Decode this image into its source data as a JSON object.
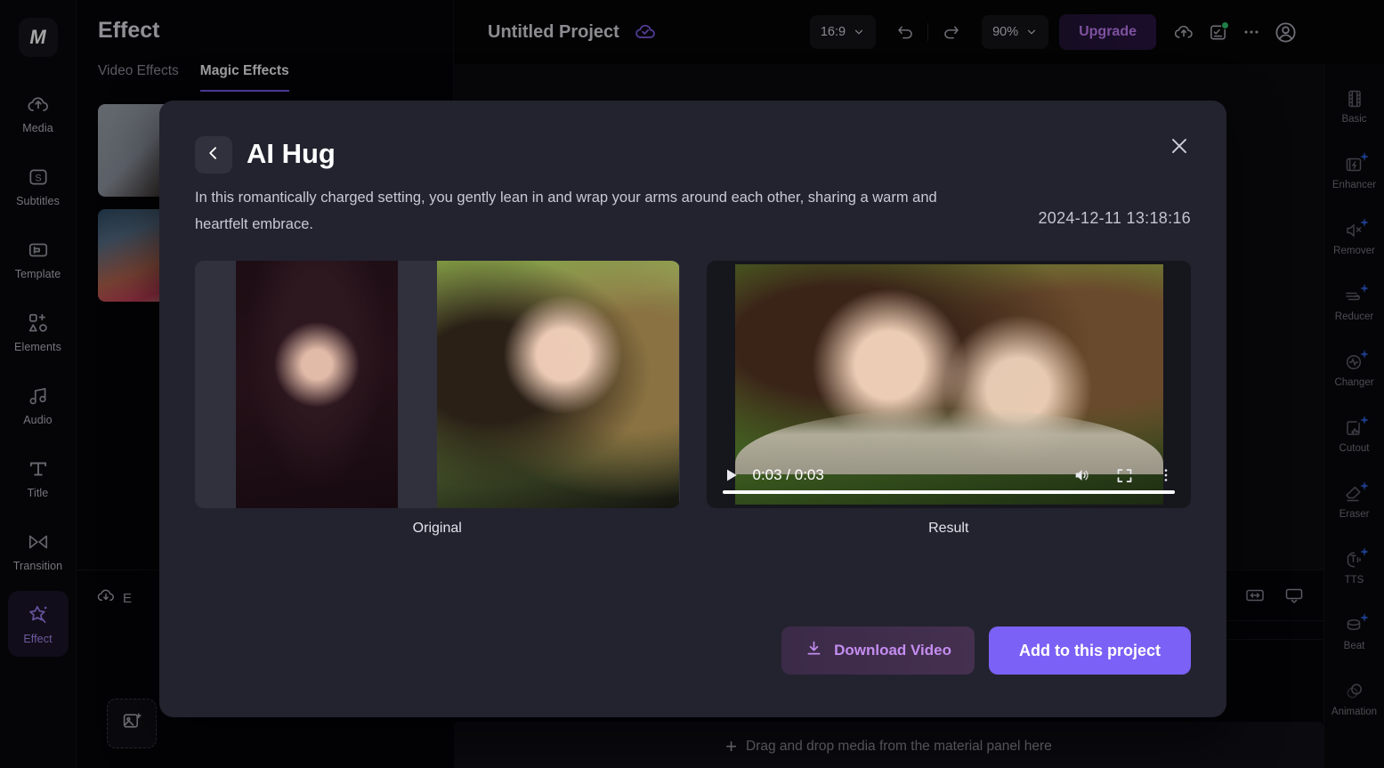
{
  "left_rail": {
    "logo": "M",
    "items": [
      {
        "label": "Media",
        "icon": "cloud-upload-icon",
        "active": false
      },
      {
        "label": "Subtitles",
        "icon": "subtitles-icon",
        "active": false
      },
      {
        "label": "Template",
        "icon": "template-icon",
        "active": false
      },
      {
        "label": "Elements",
        "icon": "elements-icon",
        "active": false
      },
      {
        "label": "Audio",
        "icon": "audio-note-icon",
        "active": false
      },
      {
        "label": "Title",
        "icon": "text-title-icon",
        "active": false
      },
      {
        "label": "Transition",
        "icon": "transition-icon",
        "active": false
      },
      {
        "label": "Effect",
        "icon": "magic-wand-star-icon",
        "active": true
      }
    ]
  },
  "effect_panel": {
    "title": "Effect",
    "tabs": [
      {
        "label": "Video Effects",
        "active": false
      },
      {
        "label": "Magic Effects",
        "active": true
      }
    ]
  },
  "topbar": {
    "project_title": "Untitled Project",
    "cloud_status_icon": "cloud-saved-icon",
    "aspect_ratio": "16:9",
    "undo_icon": "undo-icon",
    "redo_icon": "redo-icon",
    "zoom": "90%",
    "upgrade_label": "Upgrade",
    "export_icon": "cloud-export-icon",
    "tasks_icon": "task-list-icon",
    "more_icon": "more-horizontal-icon",
    "account_icon": "account-circle-icon"
  },
  "right_rail": {
    "items": [
      {
        "label": "Basic",
        "icon": "film-basic-icon",
        "ai": false
      },
      {
        "label": "Enhancer",
        "icon": "video-enhancer-icon",
        "ai": true
      },
      {
        "label": "Remover",
        "icon": "noise-remover-icon",
        "ai": true
      },
      {
        "label": "Reducer",
        "icon": "wind-reducer-icon",
        "ai": true
      },
      {
        "label": "Changer",
        "icon": "voice-changer-icon",
        "ai": true
      },
      {
        "label": "Cutout",
        "icon": "smart-cutout-icon",
        "ai": true
      },
      {
        "label": "Eraser",
        "icon": "eraser-icon",
        "ai": true
      },
      {
        "label": "TTS",
        "icon": "text-to-speech-icon",
        "ai": true
      },
      {
        "label": "Beat",
        "icon": "beat-detect-icon",
        "ai": true
      },
      {
        "label": "Animation",
        "icon": "animation-icon",
        "ai": false
      }
    ]
  },
  "timeline": {
    "export_label": "E",
    "export_icon": "cloud-download-icon",
    "fit_icon": "fit-timeline-icon",
    "display_icon": "display-ratio-icon",
    "add_media_icon": "add-image-icon",
    "dropzone_text": "Drag and drop media from the material panel here",
    "dropzone_plus": "+"
  },
  "modal": {
    "back_icon": "chevron-left-icon",
    "title": "AI Hug",
    "close_icon": "close-icon",
    "description": "In this romantically charged setting, you gently lean in and wrap your arms around each other, sharing a warm and heartfelt embrace.",
    "timestamp": "2024-12-11 13:18:16",
    "original_caption": "Original",
    "result_caption": "Result",
    "video": {
      "play_icon": "play-icon",
      "time": "0:03 / 0:03",
      "volume_icon": "volume-icon",
      "fullscreen_icon": "fullscreen-icon",
      "more_icon": "more-vertical-icon",
      "progress_percent": 100
    },
    "download_label": "Download Video",
    "download_icon": "download-icon",
    "add_label": "Add to this project"
  },
  "colors": {
    "accent_purple": "#7b61f5",
    "upgrade_text": "#c07df5",
    "modal_bg": "#23232f",
    "ai_spark": "#2d5bd0",
    "status_green": "#2fc46a"
  }
}
